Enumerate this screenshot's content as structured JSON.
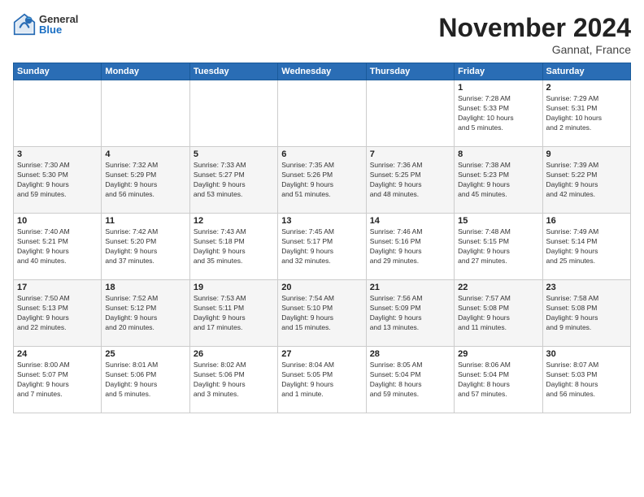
{
  "logo": {
    "general": "General",
    "blue": "Blue"
  },
  "title": {
    "month": "November 2024",
    "location": "Gannat, France"
  },
  "header": {
    "days": [
      "Sunday",
      "Monday",
      "Tuesday",
      "Wednesday",
      "Thursday",
      "Friday",
      "Saturday"
    ]
  },
  "weeks": [
    [
      {
        "day": "",
        "info": ""
      },
      {
        "day": "",
        "info": ""
      },
      {
        "day": "",
        "info": ""
      },
      {
        "day": "",
        "info": ""
      },
      {
        "day": "",
        "info": ""
      },
      {
        "day": "1",
        "info": "Sunrise: 7:28 AM\nSunset: 5:33 PM\nDaylight: 10 hours\nand 5 minutes."
      },
      {
        "day": "2",
        "info": "Sunrise: 7:29 AM\nSunset: 5:31 PM\nDaylight: 10 hours\nand 2 minutes."
      }
    ],
    [
      {
        "day": "3",
        "info": "Sunrise: 7:30 AM\nSunset: 5:30 PM\nDaylight: 9 hours\nand 59 minutes."
      },
      {
        "day": "4",
        "info": "Sunrise: 7:32 AM\nSunset: 5:29 PM\nDaylight: 9 hours\nand 56 minutes."
      },
      {
        "day": "5",
        "info": "Sunrise: 7:33 AM\nSunset: 5:27 PM\nDaylight: 9 hours\nand 53 minutes."
      },
      {
        "day": "6",
        "info": "Sunrise: 7:35 AM\nSunset: 5:26 PM\nDaylight: 9 hours\nand 51 minutes."
      },
      {
        "day": "7",
        "info": "Sunrise: 7:36 AM\nSunset: 5:25 PM\nDaylight: 9 hours\nand 48 minutes."
      },
      {
        "day": "8",
        "info": "Sunrise: 7:38 AM\nSunset: 5:23 PM\nDaylight: 9 hours\nand 45 minutes."
      },
      {
        "day": "9",
        "info": "Sunrise: 7:39 AM\nSunset: 5:22 PM\nDaylight: 9 hours\nand 42 minutes."
      }
    ],
    [
      {
        "day": "10",
        "info": "Sunrise: 7:40 AM\nSunset: 5:21 PM\nDaylight: 9 hours\nand 40 minutes."
      },
      {
        "day": "11",
        "info": "Sunrise: 7:42 AM\nSunset: 5:20 PM\nDaylight: 9 hours\nand 37 minutes."
      },
      {
        "day": "12",
        "info": "Sunrise: 7:43 AM\nSunset: 5:18 PM\nDaylight: 9 hours\nand 35 minutes."
      },
      {
        "day": "13",
        "info": "Sunrise: 7:45 AM\nSunset: 5:17 PM\nDaylight: 9 hours\nand 32 minutes."
      },
      {
        "day": "14",
        "info": "Sunrise: 7:46 AM\nSunset: 5:16 PM\nDaylight: 9 hours\nand 29 minutes."
      },
      {
        "day": "15",
        "info": "Sunrise: 7:48 AM\nSunset: 5:15 PM\nDaylight: 9 hours\nand 27 minutes."
      },
      {
        "day": "16",
        "info": "Sunrise: 7:49 AM\nSunset: 5:14 PM\nDaylight: 9 hours\nand 25 minutes."
      }
    ],
    [
      {
        "day": "17",
        "info": "Sunrise: 7:50 AM\nSunset: 5:13 PM\nDaylight: 9 hours\nand 22 minutes."
      },
      {
        "day": "18",
        "info": "Sunrise: 7:52 AM\nSunset: 5:12 PM\nDaylight: 9 hours\nand 20 minutes."
      },
      {
        "day": "19",
        "info": "Sunrise: 7:53 AM\nSunset: 5:11 PM\nDaylight: 9 hours\nand 17 minutes."
      },
      {
        "day": "20",
        "info": "Sunrise: 7:54 AM\nSunset: 5:10 PM\nDaylight: 9 hours\nand 15 minutes."
      },
      {
        "day": "21",
        "info": "Sunrise: 7:56 AM\nSunset: 5:09 PM\nDaylight: 9 hours\nand 13 minutes."
      },
      {
        "day": "22",
        "info": "Sunrise: 7:57 AM\nSunset: 5:08 PM\nDaylight: 9 hours\nand 11 minutes."
      },
      {
        "day": "23",
        "info": "Sunrise: 7:58 AM\nSunset: 5:08 PM\nDaylight: 9 hours\nand 9 minutes."
      }
    ],
    [
      {
        "day": "24",
        "info": "Sunrise: 8:00 AM\nSunset: 5:07 PM\nDaylight: 9 hours\nand 7 minutes."
      },
      {
        "day": "25",
        "info": "Sunrise: 8:01 AM\nSunset: 5:06 PM\nDaylight: 9 hours\nand 5 minutes."
      },
      {
        "day": "26",
        "info": "Sunrise: 8:02 AM\nSunset: 5:06 PM\nDaylight: 9 hours\nand 3 minutes."
      },
      {
        "day": "27",
        "info": "Sunrise: 8:04 AM\nSunset: 5:05 PM\nDaylight: 9 hours\nand 1 minute."
      },
      {
        "day": "28",
        "info": "Sunrise: 8:05 AM\nSunset: 5:04 PM\nDaylight: 8 hours\nand 59 minutes."
      },
      {
        "day": "29",
        "info": "Sunrise: 8:06 AM\nSunset: 5:04 PM\nDaylight: 8 hours\nand 57 minutes."
      },
      {
        "day": "30",
        "info": "Sunrise: 8:07 AM\nSunset: 5:03 PM\nDaylight: 8 hours\nand 56 minutes."
      }
    ]
  ]
}
